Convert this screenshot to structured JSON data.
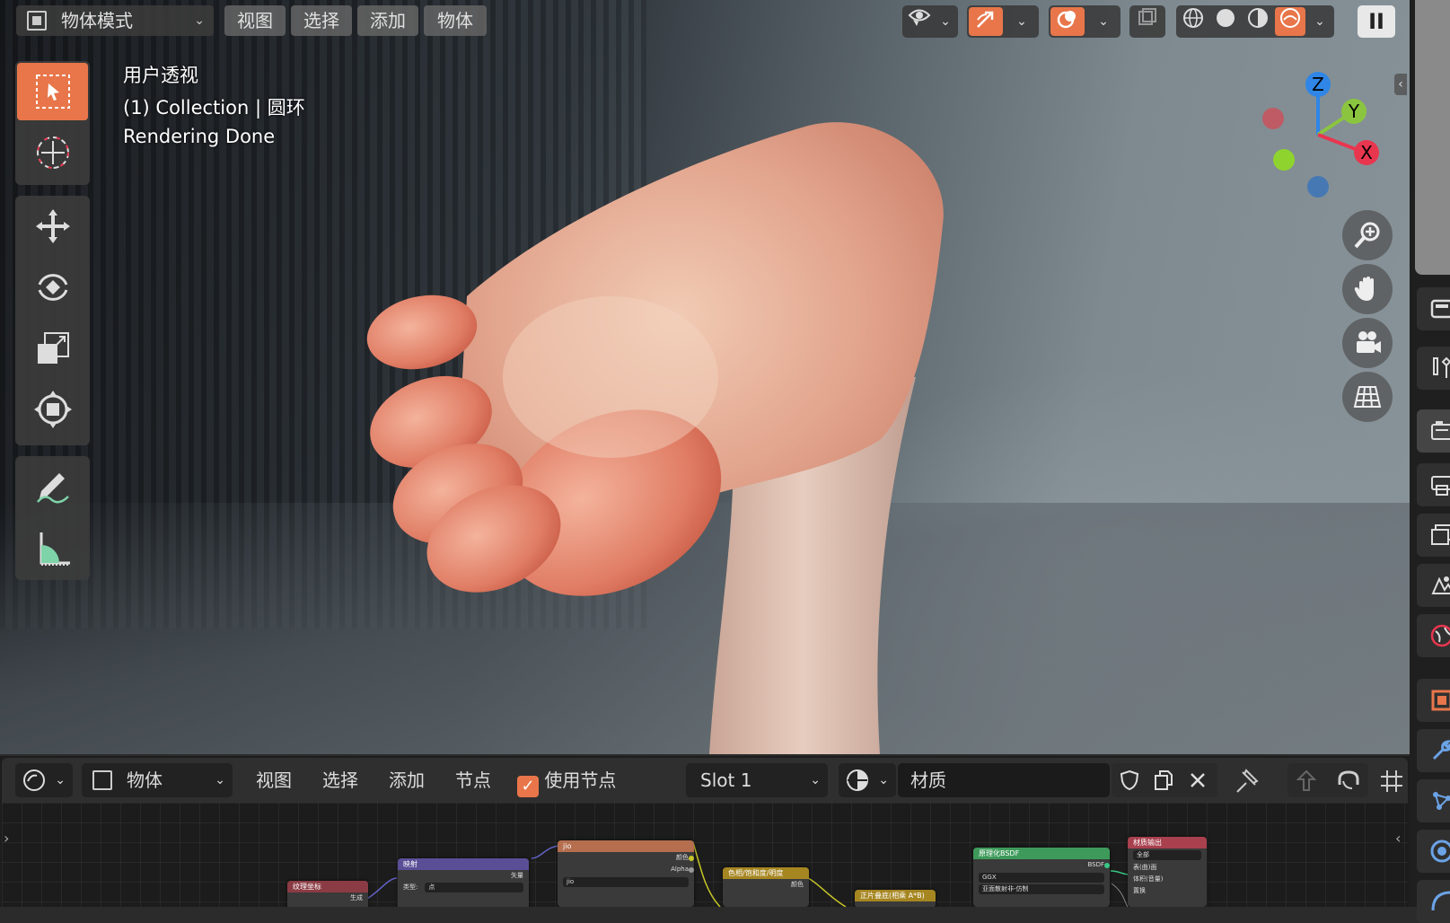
{
  "viewport": {
    "mode_label": "物体模式",
    "menus": [
      "视图",
      "选择",
      "添加",
      "物体"
    ],
    "overlay_lines": [
      "用户透视",
      "(1) Collection | 圆环",
      "Rendering Done"
    ],
    "gizmo_axes": [
      "Z",
      "Y",
      "X"
    ],
    "pause_label": "II",
    "toolbar_icons": [
      "select-box-icon",
      "cursor-icon",
      "move-icon",
      "rotate-icon",
      "scale-icon",
      "transform-icon",
      "annotate-icon",
      "measure-icon"
    ],
    "nav_icons": [
      "zoom-icon",
      "pan-hand-icon",
      "camera-view-icon",
      "ortho-grid-icon"
    ]
  },
  "colors": {
    "accent": "#e8764a",
    "axis_x": "#e8364f",
    "axis_y": "#8bc53f",
    "axis_z": "#2f86e6"
  },
  "node_editor": {
    "object_label": "物体",
    "menus": [
      "视图",
      "选择",
      "添加",
      "节点"
    ],
    "use_nodes_label": "使用节点",
    "use_nodes_checked": true,
    "slot_label": "Slot 1",
    "material_name": "材质",
    "nodes": {
      "texcoord": {
        "title": "纹理坐标",
        "rows": [
          "生成"
        ]
      },
      "mapping": {
        "title": "映射",
        "rows": [
          "矢量",
          "类型:",
          "点"
        ]
      },
      "image": {
        "title": "jio",
        "rows": [
          "颜色",
          "Alpha",
          "jio"
        ]
      },
      "hsv": {
        "title": "色相/饱和度/明度",
        "rows": [
          "颜色"
        ]
      },
      "multiply": {
        "title": "正片叠底(相乘 A*B)"
      },
      "bsdf": {
        "title": "原理化BSDF",
        "rows": [
          "BSDF",
          "GGX",
          "亚面散射非-仿制"
        ]
      },
      "output": {
        "title": "材质输出",
        "rows": [
          "全部",
          "表(曲)面",
          "体积(音量)",
          "置换"
        ]
      }
    }
  }
}
